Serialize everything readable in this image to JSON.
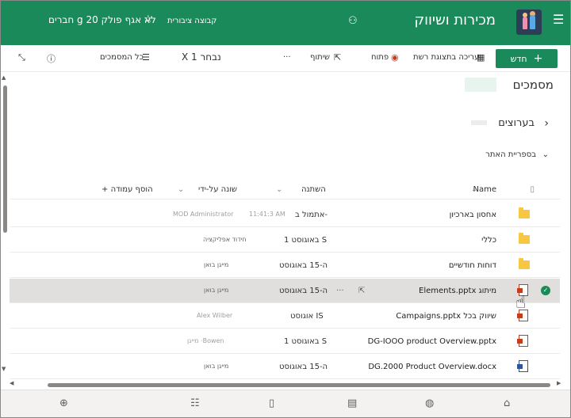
{
  "header": {
    "site_title": "מכירות ושיווק",
    "follow_label": "לא אגף פולק 20 g חברים",
    "group_type": "קבוצה ציבורית",
    "menu_icon": "hamburger-icon",
    "teams_icon": "teams-icon",
    "star_icon": "star-icon",
    "accent_color": "#1b8a5a"
  },
  "commandbar": {
    "new_label": "חדש",
    "grid_edit_label": "עריכה בתצוגת רשת",
    "open_label": "פתוח",
    "share_label": "שיתוף",
    "more_label": "···",
    "selected_label": "X 1 נבחר",
    "all_docs_label": "כל המסמכים"
  },
  "page": {
    "title": "מסמכים",
    "breadcrumb": "בערוצים",
    "library_label": "בספריית האתר"
  },
  "table": {
    "headers": {
      "name": "Name",
      "modified": "השתנה",
      "modified_by": "שונה על-ידי",
      "add_column": "+ הוסף עמודה"
    },
    "rows": [
      {
        "name": "אחסון בארכיון",
        "modified": "אתמול ב-",
        "modified_extra": "11:41:3 AM",
        "by": "MOD Administrator",
        "by_style": "muted",
        "type": "folder"
      },
      {
        "name": "כללי",
        "modified": "1 באוגוסט S",
        "by": "חידוד אפליקציה",
        "by_style": "faint",
        "type": "folder"
      },
      {
        "name": "דוחות חודשיים",
        "modified": "ה-15 באוגוסט",
        "by": "מייגן בואן",
        "by_style": "faint",
        "type": "folder"
      },
      {
        "name": "Elements.pptx מיתוג",
        "modified": "ה-15 באוגוסט",
        "by": "מייגן בואן",
        "by_style": "faint",
        "type": "ppt",
        "selected": true,
        "more": "···"
      },
      {
        "name": "Campaigns.pptx שיווק בכל",
        "modified": "אוגוסט IS",
        "by": "Alex Wilber",
        "by_style": "muted",
        "type": "ppt"
      },
      {
        "name": "DG-IOOO product Overview.pptx",
        "modified": "1 באוגוסט S",
        "by": "מייגן ·Bowen",
        "by_style": "muted",
        "type": "ppt"
      },
      {
        "name": "DG.2000 Product Overview.docx",
        "modified": "ה-15 באוגוסט",
        "by": "מייגן בואן",
        "by_style": "faint",
        "type": "docx"
      }
    ]
  },
  "bottombar": {
    "icons": [
      "home-icon",
      "globe-icon",
      "news-icon",
      "files-icon",
      "list-icon",
      "add-icon"
    ]
  }
}
